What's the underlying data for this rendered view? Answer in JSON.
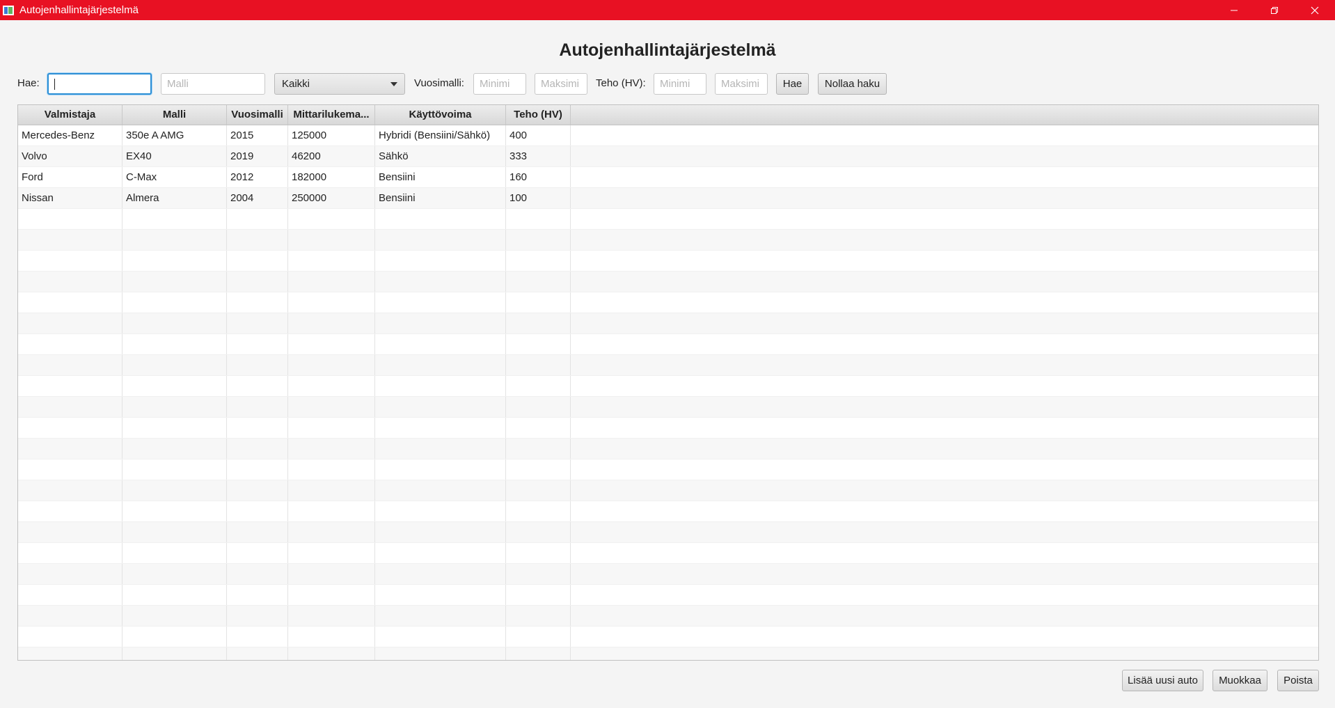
{
  "window": {
    "title": "Autojenhallintajärjestelmä",
    "controls": [
      "minimize-icon",
      "restore-icon",
      "close-icon"
    ],
    "titlebar_color": "#e81123"
  },
  "heading": "Autojenhallintajärjestelmä",
  "search": {
    "label": "Hae:",
    "query_value": "",
    "model_placeholder": "Malli",
    "fuel_selected": "Kaikki",
    "year_label": "Vuosimalli:",
    "year_min_placeholder": "Minimi",
    "year_max_placeholder": "Maksimi",
    "power_label": "Teho (HV):",
    "power_min_placeholder": "Minimi",
    "power_max_placeholder": "Maksimi",
    "search_button": "Hae",
    "reset_button": "Nollaa haku"
  },
  "table": {
    "columns": [
      "Valmistaja",
      "Malli",
      "Vuosimalli",
      "Mittarilukema...",
      "Käyttövoima",
      "Teho (HV)"
    ],
    "rows": [
      [
        "Mercedes-Benz",
        "350e A AMG",
        "2015",
        "125000",
        "Hybridi (Bensiini/Sähkö)",
        "400"
      ],
      [
        "Volvo",
        "EX40",
        "2019",
        "46200",
        "Sähkö",
        "333"
      ],
      [
        "Ford",
        "C-Max",
        "2012",
        "182000",
        "Bensiini",
        "160"
      ],
      [
        "Nissan",
        "Almera",
        "2004",
        "250000",
        "Bensiini",
        "100"
      ]
    ]
  },
  "actions": {
    "add": "Lisää uusi auto",
    "edit": "Muokkaa",
    "delete": "Poista"
  }
}
